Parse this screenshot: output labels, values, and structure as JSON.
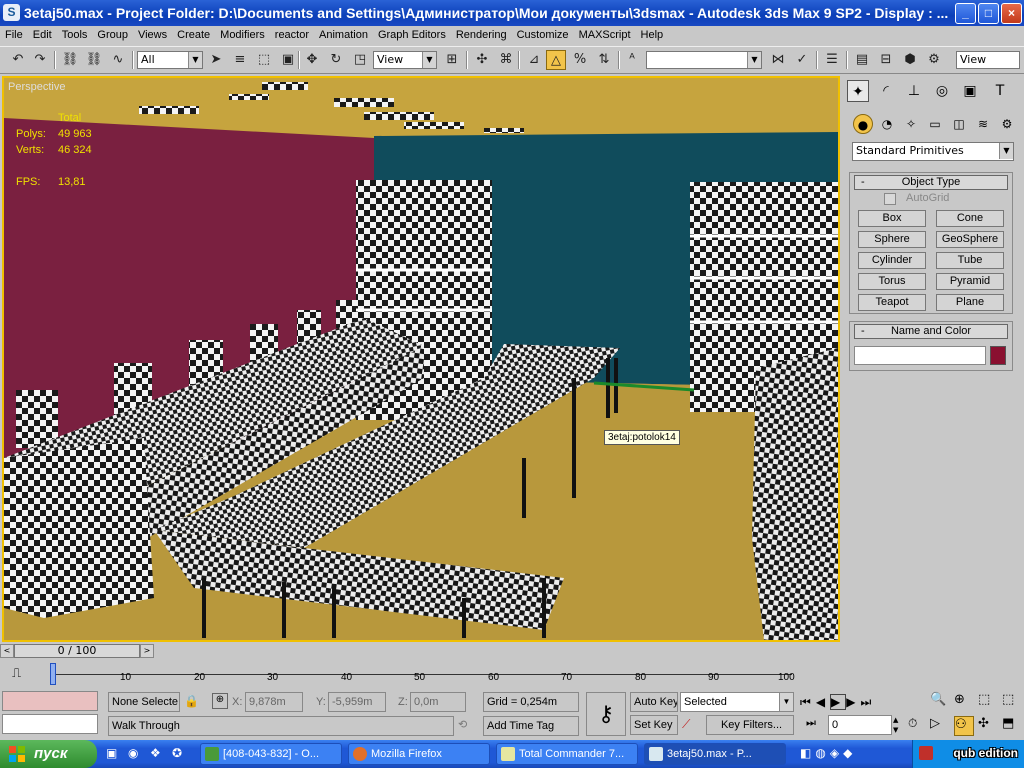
{
  "window": {
    "title": "3etaj50.max - Project Folder: D:\\Documents and Settings\\Администратор\\Мои документы\\3dsmax - Autodesk 3ds Max 9 SP2 - Display : ...",
    "minimize": "_",
    "maximize": "□",
    "close": "×"
  },
  "menu": [
    "File",
    "Edit",
    "Tools",
    "Group",
    "Views",
    "Create",
    "Modifiers",
    "reactor",
    "Animation",
    "Graph Editors",
    "Rendering",
    "Customize",
    "MAXScript",
    "Help"
  ],
  "toolbar": {
    "selection_filter": "All",
    "ref_coord": "View",
    "named_sel": "",
    "view_right": "View"
  },
  "viewport": {
    "label": "Perspective",
    "stats": {
      "total_label": "Total",
      "polys_label": "Polys:",
      "polys_value": "49 963",
      "verts_label": "Verts:",
      "verts_value": "46 324",
      "fps_label": "FPS:",
      "fps_value": "13,81"
    },
    "tooltip": "3etaj:potolok14",
    "colors": {
      "wall_left": "#7a2040",
      "wall_back": "#104c5c",
      "floor": "#b8983c",
      "ceiling": "#c6a43e",
      "active_border": "#f0c000"
    }
  },
  "command_panel": {
    "category": "Standard Primitives",
    "object_type_title": "Object Type",
    "autogrid_label": "AutoGrid",
    "autogrid_checked": false,
    "buttons": [
      "Box",
      "Cone",
      "Sphere",
      "GeoSphere",
      "Cylinder",
      "Tube",
      "Torus",
      "Pyramid",
      "Teapot",
      "Plane"
    ],
    "name_color_title": "Name and Color",
    "object_name": "",
    "object_color": "#8a1030"
  },
  "timeline": {
    "frame_display": "0 / 100",
    "ticks": [
      "10",
      "20",
      "30",
      "40",
      "50",
      "60",
      "70",
      "80",
      "90",
      "100"
    ]
  },
  "status": {
    "selection": "None Selecte",
    "x_label": "X:",
    "x_value": "9,878m",
    "y_label": "Y:",
    "y_value": "-5,959m",
    "z_label": "Z:",
    "z_value": "0,0m",
    "grid": "Grid = 0,254m",
    "prompt": "Walk Through",
    "add_time_tag": "Add Time Tag",
    "auto_key": "Auto Key",
    "set_key": "Set Key",
    "key_mode": "Selected",
    "key_filters": "Key Filters...",
    "current_frame": "0"
  },
  "taskbar": {
    "start": "пуск",
    "tasks": [
      "[408-043-832] - O...",
      "Mozilla Firefox",
      "Total Commander 7...",
      "3etaj50.max - P..."
    ],
    "watermark": "qub edition"
  }
}
